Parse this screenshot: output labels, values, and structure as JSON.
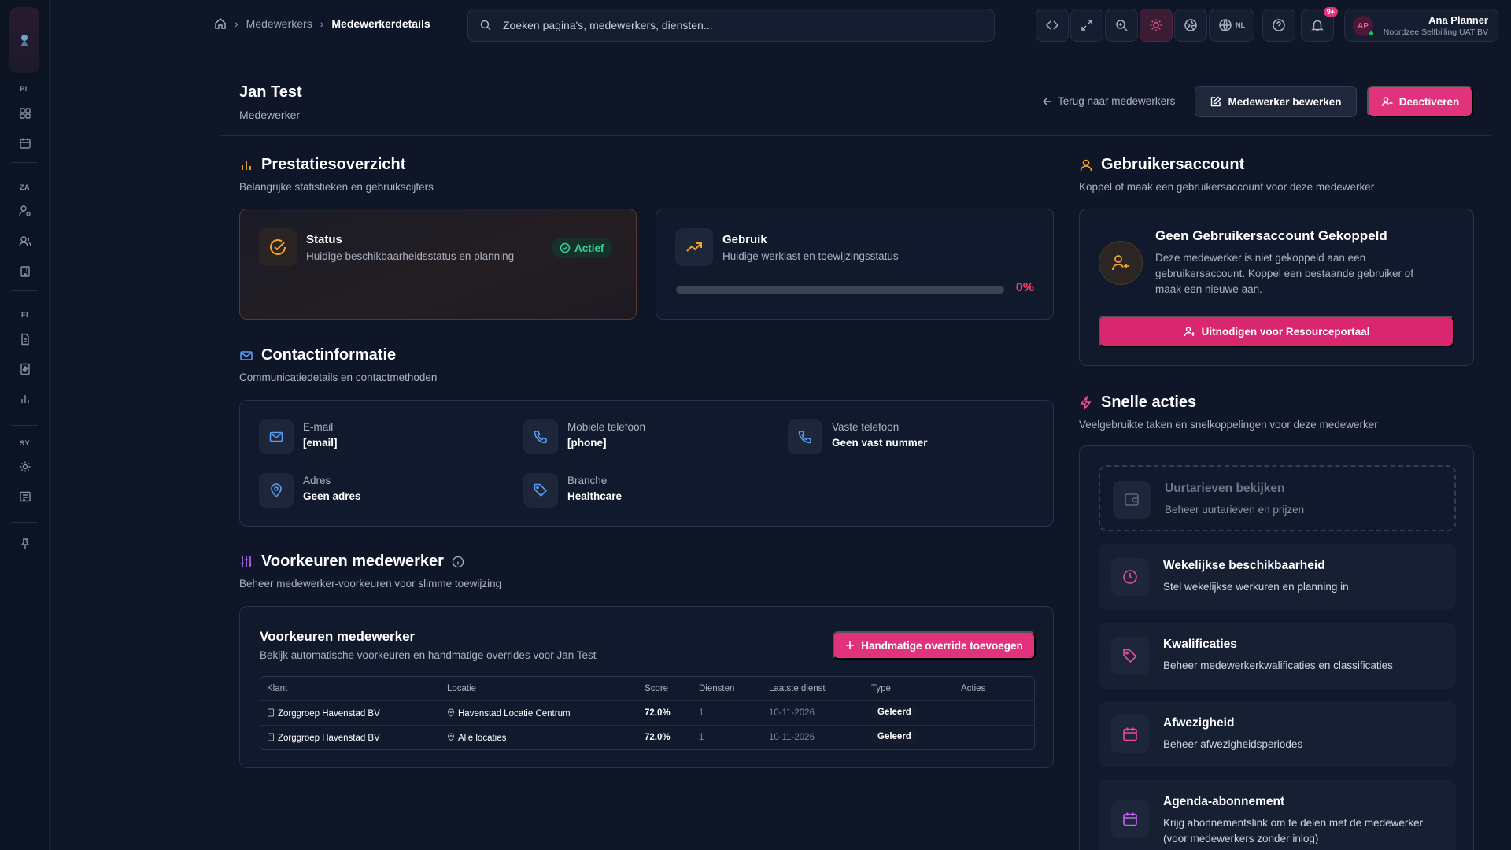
{
  "rail": {
    "sections": [
      "PL",
      "ZA",
      "FI",
      "SY"
    ]
  },
  "breadcrumb": {
    "items": [
      "Medewerkers",
      "Medewerkerdetails"
    ]
  },
  "search": {
    "placeholder": "Zoeken pagina's, medewerkers, diensten..."
  },
  "topbar": {
    "language": "NL",
    "notifications_badge": "9+",
    "user_initials": "AP",
    "user_name": "Ana Planner",
    "user_org": "Noordzee Selfbilling UAT BV"
  },
  "header": {
    "title": "Jan Test",
    "subtitle": "Medewerker",
    "back_label": "Terug naar medewerkers",
    "edit_label": "Medewerker bewerken",
    "deactivate_label": "Deactiveren"
  },
  "performance": {
    "title": "Prestatiesoverzicht",
    "description": "Belangrijke statistieken en gebruikscijfers",
    "status": {
      "title": "Status",
      "description": "Huidige beschikbaarheidsstatus en planning",
      "badge": "Actief"
    },
    "usage": {
      "title": "Gebruik",
      "description": "Huidige werklast en toewijzingsstatus",
      "value_label": "0%",
      "value_fraction": 0
    }
  },
  "contact": {
    "title": "Contactinformatie",
    "description": "Communicatiedetails en contactmethoden",
    "email_label": "E-mail",
    "email_value": "[email]",
    "mobile_label": "Mobiele telefoon",
    "mobile_value": "[phone]",
    "landline_label": "Vaste telefoon",
    "landline_value": "Geen vast nummer",
    "address_label": "Adres",
    "address_value": "Geen adres",
    "branch_label": "Branche",
    "branch_value": "Healthcare"
  },
  "preferences": {
    "title": "Voorkeuren medewerker",
    "description": "Beheer medewerker-voorkeuren voor slimme toewijzing",
    "card_title": "Voorkeuren medewerker",
    "card_description": "Bekijk automatische voorkeuren en handmatige overrides voor Jan Test",
    "add_override_label": "Handmatige override toevoegen",
    "columns": [
      "Klant",
      "Locatie",
      "Score",
      "Diensten",
      "Laatste dienst",
      "Type",
      "Acties"
    ],
    "rows": [
      {
        "klant": "Zorggroep Havenstad BV",
        "locatie": "Havenstad Locatie Centrum",
        "score": "72.0%",
        "diensten": "1",
        "laatste": "10-11-2026",
        "type": "Geleerd"
      },
      {
        "klant": "Zorggroep Havenstad BV",
        "locatie": "Alle locaties",
        "score": "72.0%",
        "diensten": "1",
        "laatste": "10-11-2026",
        "type": "Geleerd"
      }
    ]
  },
  "account": {
    "title": "Gebruikersaccount",
    "description": "Koppel of maak een gebruikersaccount voor deze medewerker",
    "card_title": "Geen Gebruikersaccount Gekoppeld",
    "card_description": "Deze medewerker is niet gekoppeld aan een gebruikersaccount. Koppel een bestaande gebruiker of maak een nieuwe aan.",
    "invite_label": "Uitnodigen voor Resourceportaal"
  },
  "quick_actions": {
    "title": "Snelle acties",
    "description": "Veelgebruikte taken en snelkoppelingen voor deze medewerker",
    "items": [
      {
        "title": "Uurtarieven bekijken",
        "description": "Beheer uurtarieven en prijzen"
      },
      {
        "title": "Wekelijkse beschikbaarheid",
        "description": "Stel wekelijkse werkuren en planning in"
      },
      {
        "title": "Kwalificaties",
        "description": "Beheer medewerkerkwalificaties en classificaties"
      },
      {
        "title": "Afwezigheid",
        "description": "Beheer afwezigheidsperiodes"
      },
      {
        "title": "Agenda-abonnement",
        "description": "Krijg abonnementslink om te delen met de medewerker (voor medewerkers zonder inlog)"
      }
    ]
  },
  "colors": {
    "accent": "#e0337b",
    "success": "#34d399",
    "background": "#0f1628"
  }
}
